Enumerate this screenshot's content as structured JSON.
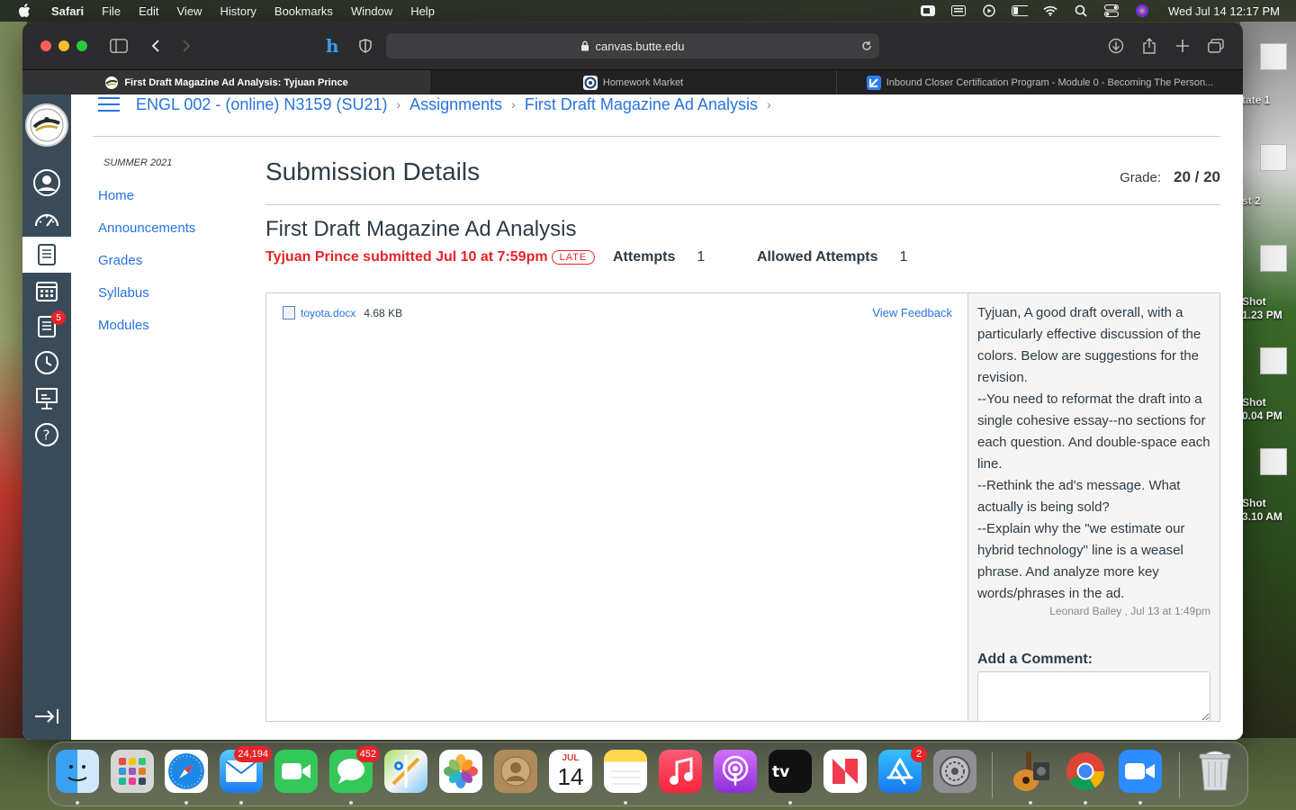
{
  "menubar": {
    "app": "Safari",
    "menus": [
      "File",
      "Edit",
      "View",
      "History",
      "Bookmarks",
      "Window",
      "Help"
    ],
    "clock": "Wed Jul 14  12:17 PM"
  },
  "desktop": {
    "items": [
      "tate 1",
      "st 2",
      "Shot\n1.23 PM",
      "Shot\n0.04 PM",
      "Shot\n3.10 AM"
    ]
  },
  "browser": {
    "url": "canvas.butte.edu",
    "tabs": [
      {
        "title": "First Draft Magazine Ad Analysis: Tyjuan Prince",
        "active": true
      },
      {
        "title": "Homework Market",
        "active": false
      },
      {
        "title": "Inbound Closer Certification Program - Module 0 - Becoming The Person...",
        "active": false
      }
    ]
  },
  "global_nav": {
    "inbox_badge": "5"
  },
  "breadcrumb": {
    "items": [
      "ENGL 002 - (online) N3159 (SU21)",
      "Assignments",
      "First Draft Magazine Ad Analysis"
    ]
  },
  "course_nav": {
    "term": "SUMMER 2021",
    "items": [
      "Home",
      "Announcements",
      "Grades",
      "Syllabus",
      "Modules"
    ]
  },
  "submission": {
    "heading": "Submission Details",
    "grade_label": "Grade:",
    "grade_value": "20 / 20",
    "assignment_title": "First Draft Magazine Ad Analysis",
    "submitted_text": "Tyjuan Prince submitted Jul 10 at 7:59pm",
    "late_label": "LATE",
    "attempts_label": "Attempts",
    "attempts_value": "1",
    "allowed_label": "Allowed Attempts",
    "allowed_value": "1",
    "file_name": "toyota.docx",
    "file_size": "4.68 KB",
    "view_feedback": "View Feedback"
  },
  "comments": {
    "text": [
      "Tyjuan,  A good draft overall, with a particularly effective discussion of the colors.  Below are suggestions for the revision.",
      "--You need to reformat the draft into a single cohesive essay--no sections for each question.  And double-space each line.",
      "--Rethink the ad's message.  What actually is being sold?",
      "--Explain why the \"we estimate our hybrid technology\" line is a weasel phrase.  And analyze more key words/phrases in the ad."
    ],
    "author_meta": "Leonard Bailey , Jul 13 at 1:49pm",
    "add_label": "Add a Comment:"
  },
  "dock": {
    "mail_badge": "24,194",
    "messages_badge": "452",
    "calendar_month": "JUL",
    "calendar_day": "14",
    "appstore_badge": "2",
    "apps": [
      "finder-icon",
      "launchpad-icon",
      "safari-icon",
      "mail-icon",
      "facetime-icon",
      "messages-icon",
      "maps-icon",
      "photos-icon",
      "contacts-icon",
      "calendar-icon",
      "notes-icon",
      "music-icon",
      "podcasts-icon",
      "tv-icon",
      "news-icon",
      "appstore-icon",
      "settings-icon",
      "garageband-icon",
      "chrome-icon",
      "zoom-icon",
      "trash-icon"
    ]
  },
  "colors": {
    "canvas_blue": "#2773e2",
    "canvas_nav": "#394b58",
    "late_red": "#e62429",
    "text_dark": "#2d3b45"
  }
}
